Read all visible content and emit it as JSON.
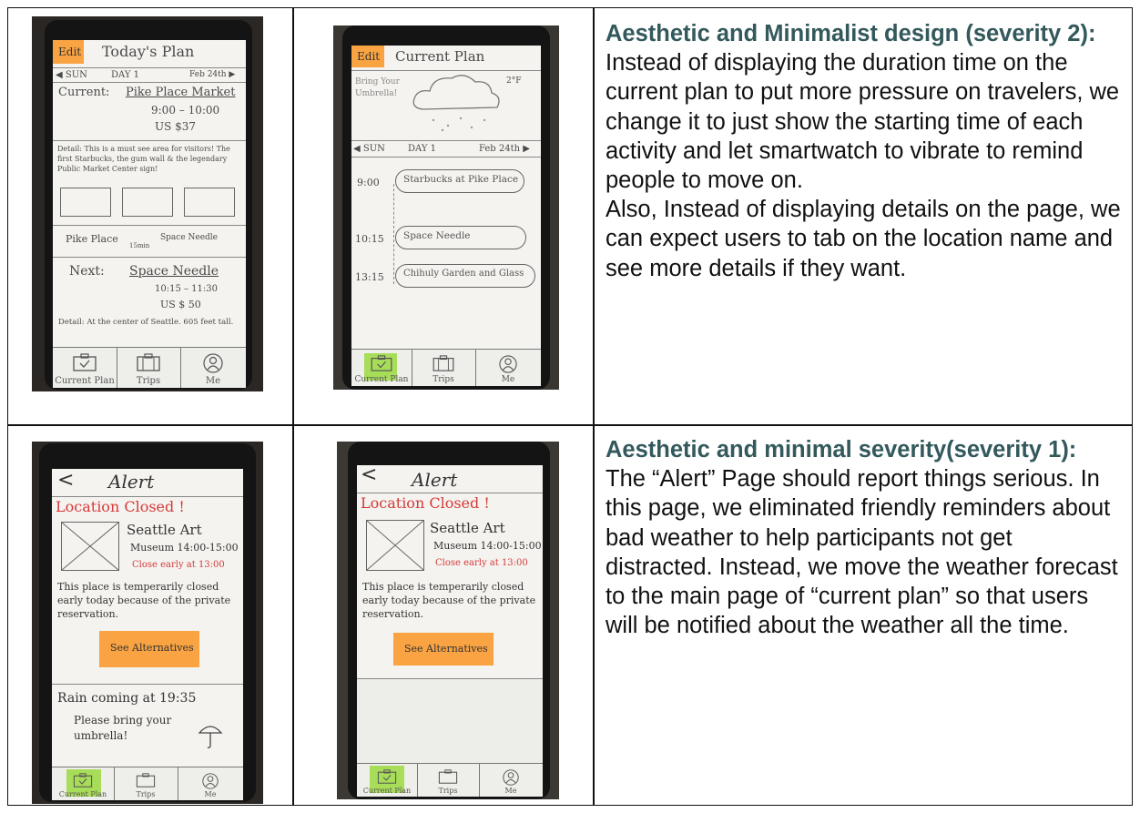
{
  "row1": {
    "left_proto": {
      "edit": "Edit",
      "title": "Today's Plan",
      "day_left": "◀ SUN",
      "day": "DAY 1",
      "date": "Feb 24th ▶",
      "current_label": "Current:",
      "current_place": "Pike Place Market",
      "current_time": "9:00 – 10:00",
      "current_cost": "US $37",
      "detail": "Detail: This is a must see area for visitors! The first Starbucks, the gum wall & the legendary Public Market Center sign!",
      "transit_from": "Pike Place",
      "transit_mins": "15min",
      "transit_to": "Space Needle",
      "next_label": "Next:",
      "next_place": "Space Needle",
      "next_time": "10:15 – 11:30",
      "next_cost": "US $ 50",
      "next_detail": "Detail: At the center of Seattle. 605 feet tall.",
      "tabs": [
        "Current Plan",
        "Trips",
        "Me"
      ]
    },
    "right_proto": {
      "edit": "Edit",
      "title": "Current Plan",
      "weather_note": "Bring Your Umbrella!",
      "temp": "2°F",
      "day_left": "◀ SUN",
      "day": "DAY 1",
      "date": "Feb 24th ▶",
      "schedule": [
        {
          "time": "9:00",
          "place": "Starbucks at Pike Place"
        },
        {
          "time": "10:15",
          "place": "Space Needle"
        },
        {
          "time": "13:15",
          "place": "Chihuly Garden and Glass"
        }
      ],
      "tabs": [
        "Current Plan",
        "Trips",
        "Me"
      ]
    },
    "heading": "Aesthetic and Minimalist design (severity 2):",
    "body1": "Instead of displaying the duration time on the current plan to put more pressure on travelers, we change it to just show the starting time of each activity and let smartwatch to vibrate to remind people to move on.",
    "body2": "Also, Instead of displaying details on the page, we can expect users to tab on the location name and see more details if they want."
  },
  "row2": {
    "left_proto": {
      "back": "<",
      "title": "Alert",
      "closed": "Location Closed !",
      "place1": "Seattle Art",
      "place2": "Museum 14:00-15:00",
      "early": "Close early at 13:00",
      "note": "This place is temperarily closed early today because of the private reservation.",
      "cta": "See Alternatives",
      "rain": "Rain coming at 19:35",
      "umbrella": "Please bring your umbrella!",
      "tabs": [
        "Current Plan",
        "Trips",
        "Me"
      ]
    },
    "right_proto": {
      "back": "<",
      "title": "Alert",
      "closed": "Location Closed !",
      "place1": "Seattle Art",
      "place2": "Museum 14:00-15:00",
      "early": "Close early at 13:00",
      "note": "This place is temperarily closed early today because of the private reservation.",
      "cta": "See Alternatives",
      "tabs": [
        "Current Plan",
        "Trips",
        "Me"
      ]
    },
    "heading": "Aesthetic and minimal severity(severity 1):",
    "body": "The “Alert” Page should report things serious. In this page, we eliminated friendly reminders about bad weather to help participants not get distracted. Instead, we move the weather forecast to the main page of “current plan” so that users will be notified about the weather all the time."
  },
  "colors": {
    "heading": "#33595c",
    "sticky_orange": "#f9a342",
    "sticky_green": "#a8dd5a",
    "alert_red": "#d63a3a"
  },
  "icons": [
    "suitcase-check-icon",
    "suitcase-icon",
    "person-icon",
    "cloud-icon",
    "umbrella-icon",
    "placeholder-image-icon"
  ]
}
